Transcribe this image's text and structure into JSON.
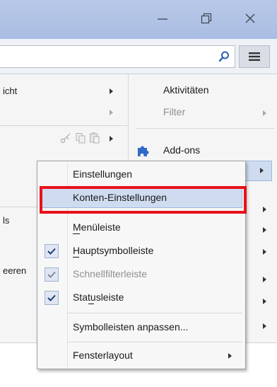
{
  "window": {
    "minimize_glyph": "—",
    "maximize_icon": "restore-icon",
    "close_glyph": "✕"
  },
  "toolbar": {
    "search_placeholder": "",
    "search_icon": "magnifier-icon",
    "menu_icon": "hamburger-icon"
  },
  "left_menu": {
    "items": [
      {
        "label": "icht",
        "has_submenu": true,
        "enabled": true
      },
      {
        "label": "",
        "has_submenu": true,
        "enabled": false
      },
      {
        "label": "",
        "has_submenu": true,
        "enabled": true,
        "icons": [
          "scissors-icon",
          "copy-icon",
          "paste-icon"
        ]
      },
      {
        "label": "ls",
        "has_submenu": false,
        "enabled": true
      },
      {
        "label": "eeren",
        "has_submenu": false,
        "enabled": true
      }
    ]
  },
  "right_menu": {
    "items": [
      {
        "label": "Aktivitäten",
        "enabled": true,
        "has_submenu": false
      },
      {
        "label": "Filter",
        "enabled": false,
        "has_submenu": true
      },
      {
        "label": "Add-ons",
        "enabled": true,
        "has_submenu": false,
        "icon": "puzzle-piece-icon"
      }
    ]
  },
  "submenu": {
    "items": [
      {
        "label": "Einstellungen",
        "checked": false,
        "enabled": true
      },
      {
        "label": "Konten-Einstellungen",
        "checked": false,
        "enabled": true,
        "highlighted": true
      },
      {
        "label": "Menüleiste",
        "checked": false,
        "enabled": true,
        "access_key": "M"
      },
      {
        "label": "Hauptsymbolleiste",
        "checked": true,
        "enabled": true,
        "access_key": "H"
      },
      {
        "label": "Schnellfilterleiste",
        "checked": true,
        "enabled": false
      },
      {
        "label": "Statusleiste",
        "checked": true,
        "enabled": true,
        "access_key": "u"
      },
      {
        "label": "Symbolleisten anpassen...",
        "checked": false,
        "enabled": true
      },
      {
        "label": "Fensterlayout",
        "checked": false,
        "enabled": true,
        "has_submenu": true
      }
    ]
  },
  "colors": {
    "highlight_border": "#e8121b",
    "selection": "#cfdcf0",
    "titlebar": "#aebfe0",
    "puzzle": "#2e6bc7"
  }
}
